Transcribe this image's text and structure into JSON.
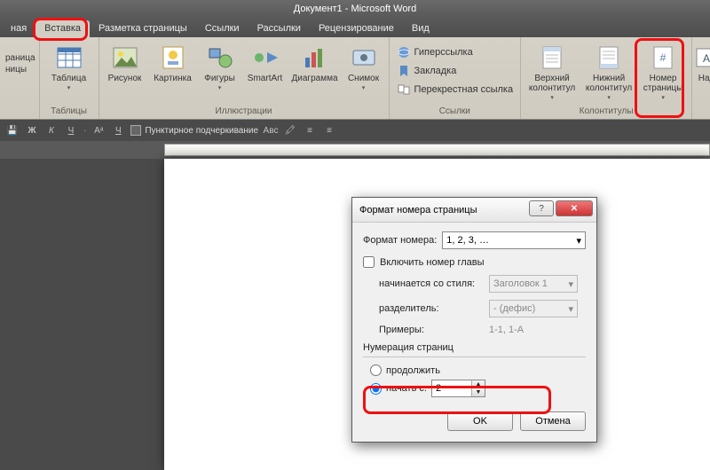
{
  "title": "Документ1 - Microsoft Word",
  "tabs": {
    "home_partial": "ная",
    "insert": "Вставка",
    "layout": "Разметка страницы",
    "references": "Ссылки",
    "mailings": "Рассылки",
    "review": "Рецензирование",
    "view": "Вид"
  },
  "ribbon": {
    "pages": {
      "label_partial1": "раница",
      "label_partial2": "ницы",
      "group": ""
    },
    "tables": {
      "btn": "Таблица",
      "group": "Таблицы"
    },
    "illustrations": {
      "picture": "Рисунок",
      "clipart": "Картинка",
      "shapes": "Фигуры",
      "smartart": "SmartArt",
      "chart": "Диаграмма",
      "screenshot": "Снимок",
      "group": "Иллюстрации"
    },
    "links": {
      "hyperlink": "Гиперссылка",
      "bookmark": "Закладка",
      "crossref": "Перекрестная ссылка",
      "group": "Ссылки"
    },
    "headerfooter": {
      "header": "Верхний\nколонтитул",
      "footer": "Нижний\nколонтитул",
      "pagenum": "Номер\nстраницы",
      "group": "Колонтитулы"
    },
    "text_partial": "Над"
  },
  "formatbar": {
    "dotted_underline": "Пунктирное подчеркивание"
  },
  "dialog": {
    "title": "Формат номера страницы",
    "format_label": "Формат номера:",
    "format_value": "1, 2, 3, …",
    "include_chapter": "Включить номер главы",
    "starts_with_style": "начинается со стиля:",
    "starts_with_value": "Заголовок 1",
    "separator_label": "разделитель:",
    "separator_value": "-   (дефис)",
    "examples_label": "Примеры:",
    "examples_value": "1-1, 1-A",
    "numbering_section": "Нумерация страниц",
    "continue": "продолжить",
    "start_at": "начать с:",
    "start_value": "2",
    "ok": "OK",
    "cancel": "Отмена"
  }
}
